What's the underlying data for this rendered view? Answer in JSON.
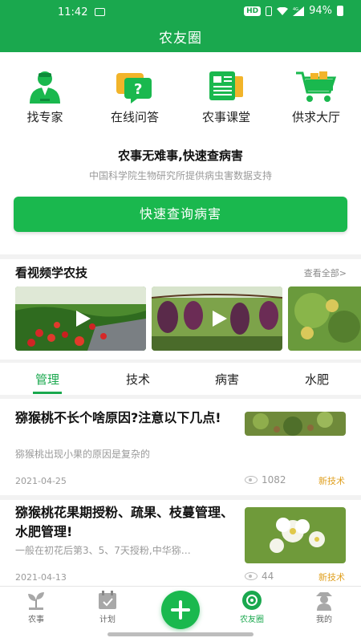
{
  "status": {
    "time": "11:42",
    "hd": "HD",
    "net": "4G",
    "battery": "94%"
  },
  "app": {
    "title": "农友圈"
  },
  "quick_actions": [
    {
      "label": "找专家",
      "icon": "expert-icon"
    },
    {
      "label": "在线问答",
      "icon": "qa-chat-icon"
    },
    {
      "label": "农事课堂",
      "icon": "classroom-icon"
    },
    {
      "label": "供求大厅",
      "icon": "cart-icon"
    }
  ],
  "slogan": "农事无难事,快速查病害",
  "sub_slogan": "中国科学院生物研究所提供病虫害数据支持",
  "query_button": "快速查询病害",
  "videos": {
    "title": "看视频学农技",
    "view_all": "查看全部>"
  },
  "tabs": [
    "管理",
    "技术",
    "病害",
    "水肥"
  ],
  "articles": [
    {
      "title": "猕猴桃不长个啥原因?注意以下几点!",
      "summary": "猕猴桃出现小果的原因是复杂的",
      "date": "2021-04-25",
      "views": "1082",
      "tag": "新技术"
    },
    {
      "title": "猕猴桃花果期授粉、疏果、枝蔓管理、水肥管理!",
      "summary": "一般在初花后第3、5、7天授粉,中华猕…",
      "date": "2021-04-13",
      "views": "44",
      "tag": "新技术"
    }
  ],
  "bottom_nav": [
    {
      "label": "农事",
      "icon": "seedling-icon"
    },
    {
      "label": "计划",
      "icon": "calendar-icon"
    },
    {
      "label": "农友圈",
      "icon": "circle-icon"
    },
    {
      "label": "我的",
      "icon": "farmer-icon"
    }
  ],
  "colors": {
    "brand": "#1aa84e",
    "tag": "#e0a020"
  }
}
